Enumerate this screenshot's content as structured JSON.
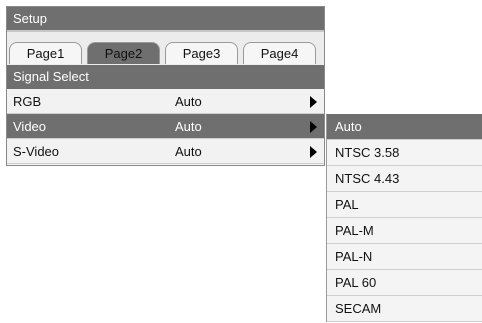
{
  "window": {
    "title": "Setup"
  },
  "tabs": [
    {
      "label": "Page1",
      "active": false
    },
    {
      "label": "Page2",
      "active": true
    },
    {
      "label": "Page3",
      "active": false
    },
    {
      "label": "Page4",
      "active": false
    }
  ],
  "section": {
    "title": "Signal Select"
  },
  "rows": [
    {
      "label": "RGB",
      "value": "Auto",
      "selected": false,
      "icon": "triangle-right-icon"
    },
    {
      "label": "Video",
      "value": "Auto",
      "selected": true,
      "icon": "triangle-right-icon"
    },
    {
      "label": "S-Video",
      "value": "Auto",
      "selected": false,
      "icon": "triangle-right-icon"
    }
  ],
  "submenu": {
    "options": [
      "Auto",
      "NTSC 3.58",
      "NTSC 4.43",
      "PAL",
      "PAL-M",
      "PAL-N",
      "PAL 60",
      "SECAM"
    ],
    "selected_index": 0
  },
  "colors": {
    "header_bg": "#6f6f6f",
    "panel_bg": "#f2f2f2",
    "highlight_bg": "#6f6f6f"
  }
}
